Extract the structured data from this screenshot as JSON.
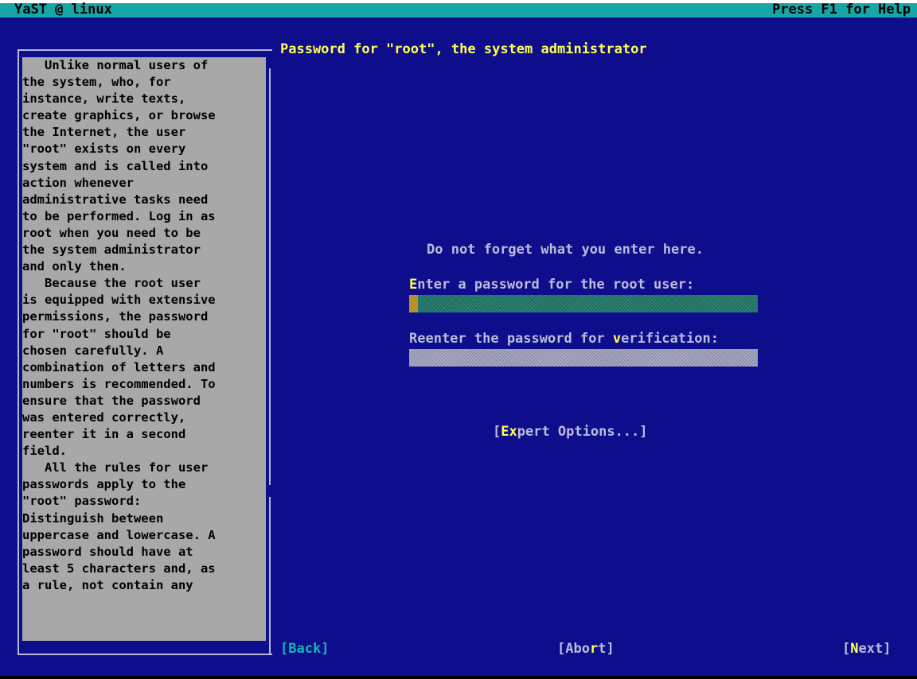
{
  "topbar": {
    "left": "YaST @ linux",
    "right": "Press F1 for Help"
  },
  "help": {
    "text": "   Unlike normal users of\nthe system, who, for\ninstance, write texts,\ncreate graphics, or browse\nthe Internet, the user\n\"root\" exists on every\nsystem and is called into\naction whenever\nadministrative tasks need\nto be performed. Log in as\nroot when you need to be\nthe system administrator\nand only then.\n   Because the root user\nis equipped with extensive\npermissions, the password\nfor \"root\" should be\nchosen carefully. A\ncombination of letters and\nnumbers is recommended. To\nensure that the password\nwas entered correctly,\nreenter it in a second\nfield.\n   All the rules for user\npasswords apply to the\n\"root\" password:\nDistinguish between\nuppercase and lowercase. A\npassword should have at\nleast 5 characters and, as\na rule, not contain any"
  },
  "dialog": {
    "title": "Password for \"root\", the system administrator",
    "hint": "Do not forget what you enter here.",
    "password_label_hot": "E",
    "password_label_rest": "nter a password for the root user:",
    "verify_label_pre": "Reenter the password for ",
    "verify_label_hot": "v",
    "verify_label_post": "erification:",
    "password_value": "",
    "verify_value": ""
  },
  "buttons": {
    "expert_pre": "[",
    "expert_hot": "Ex",
    "expert_post": "pert Options...]",
    "back": "[Back]",
    "abort_pre": "[Abo",
    "abort_hot": "r",
    "abort_post": "t]",
    "next_pre": "[",
    "next_hot": "N",
    "next_post": "ext]"
  },
  "colors": {
    "background": "#0e0e8c",
    "topbar": "#18a5a5",
    "help_panel": "#a8a8a8",
    "title": "#ffff55",
    "hotkey": "#ffff55"
  }
}
